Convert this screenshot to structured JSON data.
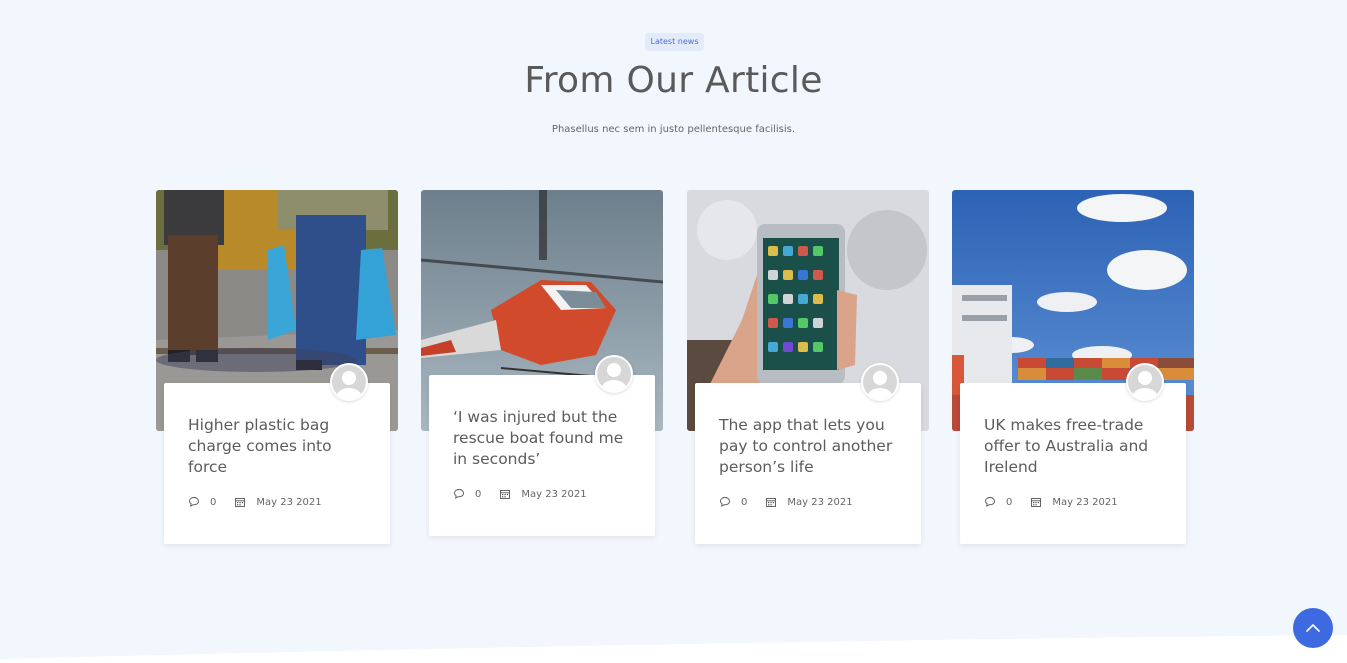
{
  "section": {
    "badge": "Latest news",
    "title": "From Our Article",
    "subtitle": "Phasellus nec sem in justo pellentesque facilisis."
  },
  "articles": [
    {
      "title": "Higher plastic bag charge comes into force",
      "comments": "0",
      "date": "May 23 2021"
    },
    {
      "title": "‘I was injured but the rescue boat found me in seconds’",
      "comments": "0",
      "date": "May 23 2021"
    },
    {
      "title": "The app that lets you pay to control another person’s life",
      "comments": "0",
      "date": "May 23 2021"
    },
    {
      "title": "UK makes free-trade offer to Australia and Irelend",
      "comments": "0",
      "date": "May 23 2021"
    }
  ],
  "icons": {
    "comment": "comment-icon",
    "calendar": "calendar-icon",
    "avatar": "user-avatar-icon",
    "scroll_top": "chevron-up-icon"
  },
  "colors": {
    "background": "#f2f6fd",
    "accent": "#3e6ae1",
    "badge_bg": "#e3ebfb"
  }
}
